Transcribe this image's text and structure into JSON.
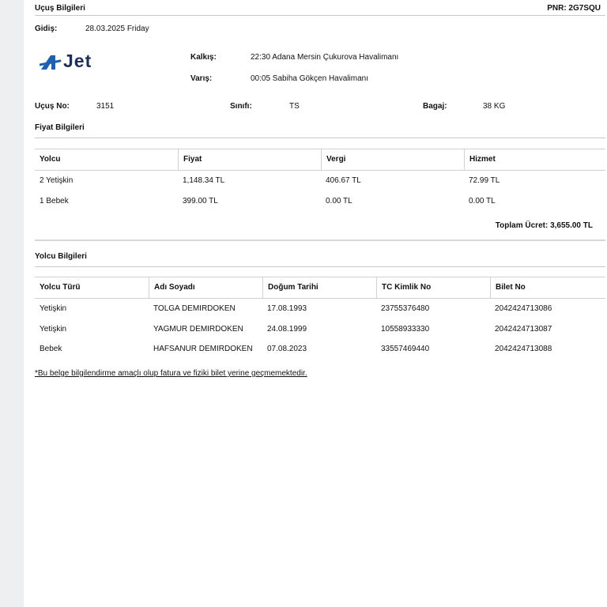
{
  "header": {
    "title": "Uçuş Bilgileri",
    "pnr": "PNR: 2G7SQU"
  },
  "flight": {
    "gidis_label": "Gidiş:",
    "gidis_value": "28.03.2025 Friday",
    "logo_text": "Jet",
    "kalkis_label": "Kalkış:",
    "kalkis_value": "22:30 Adana Mersin Çukurova Havalimanı",
    "varis_label": "Varış:",
    "varis_value": "00:05 Sabiha Gökçen Havalimanı",
    "ucus_no_label": "Uçuş No:",
    "ucus_no_value": "3151",
    "sinif_label": "Sınıfı:",
    "sinif_value": "TS",
    "bagaj_label": "Bagaj:",
    "bagaj_value": "38 KG"
  },
  "price": {
    "section_title": "Fiyat Bilgileri",
    "headers": [
      "Yolcu",
      "Fiyat",
      "Vergi",
      "Hizmet"
    ],
    "rows": [
      [
        "2 Yetişkin",
        "1,148.34 TL",
        "406.67 TL",
        "72.99 TL"
      ],
      [
        "1 Bebek",
        "399.00 TL",
        "0.00 TL",
        "0.00 TL"
      ]
    ],
    "total": "Toplam Ücret: 3,655.00 TL"
  },
  "passengers": {
    "section_title": "Yolcu Bilgileri",
    "headers": [
      "Yolcu Türü",
      "Adı Soyadı",
      "Doğum Tarihi",
      "TC Kimlik No",
      "Bilet No"
    ],
    "rows": [
      [
        "Yetişkin",
        "TOLGA DEMIRDOKEN",
        "17.08.1993",
        "23755376480",
        "2042424713086"
      ],
      [
        "Yetişkin",
        "YAGMUR DEMIRDOKEN",
        "24.08.1999",
        "10558933330",
        "2042424713087"
      ],
      [
        "Bebek",
        "HAFSANUR DEMIRDOKEN",
        "07.08.2023",
        "33557469440",
        "2042424713088"
      ]
    ]
  },
  "footer": {
    "note": "*Bu belge bilgilendirme amaçlı olup fatura ve fiziki bilet yerine geçmemektedir."
  },
  "colors": {
    "logo_blue": "#1f5fb0",
    "logo_navy": "#1c2f5a"
  }
}
